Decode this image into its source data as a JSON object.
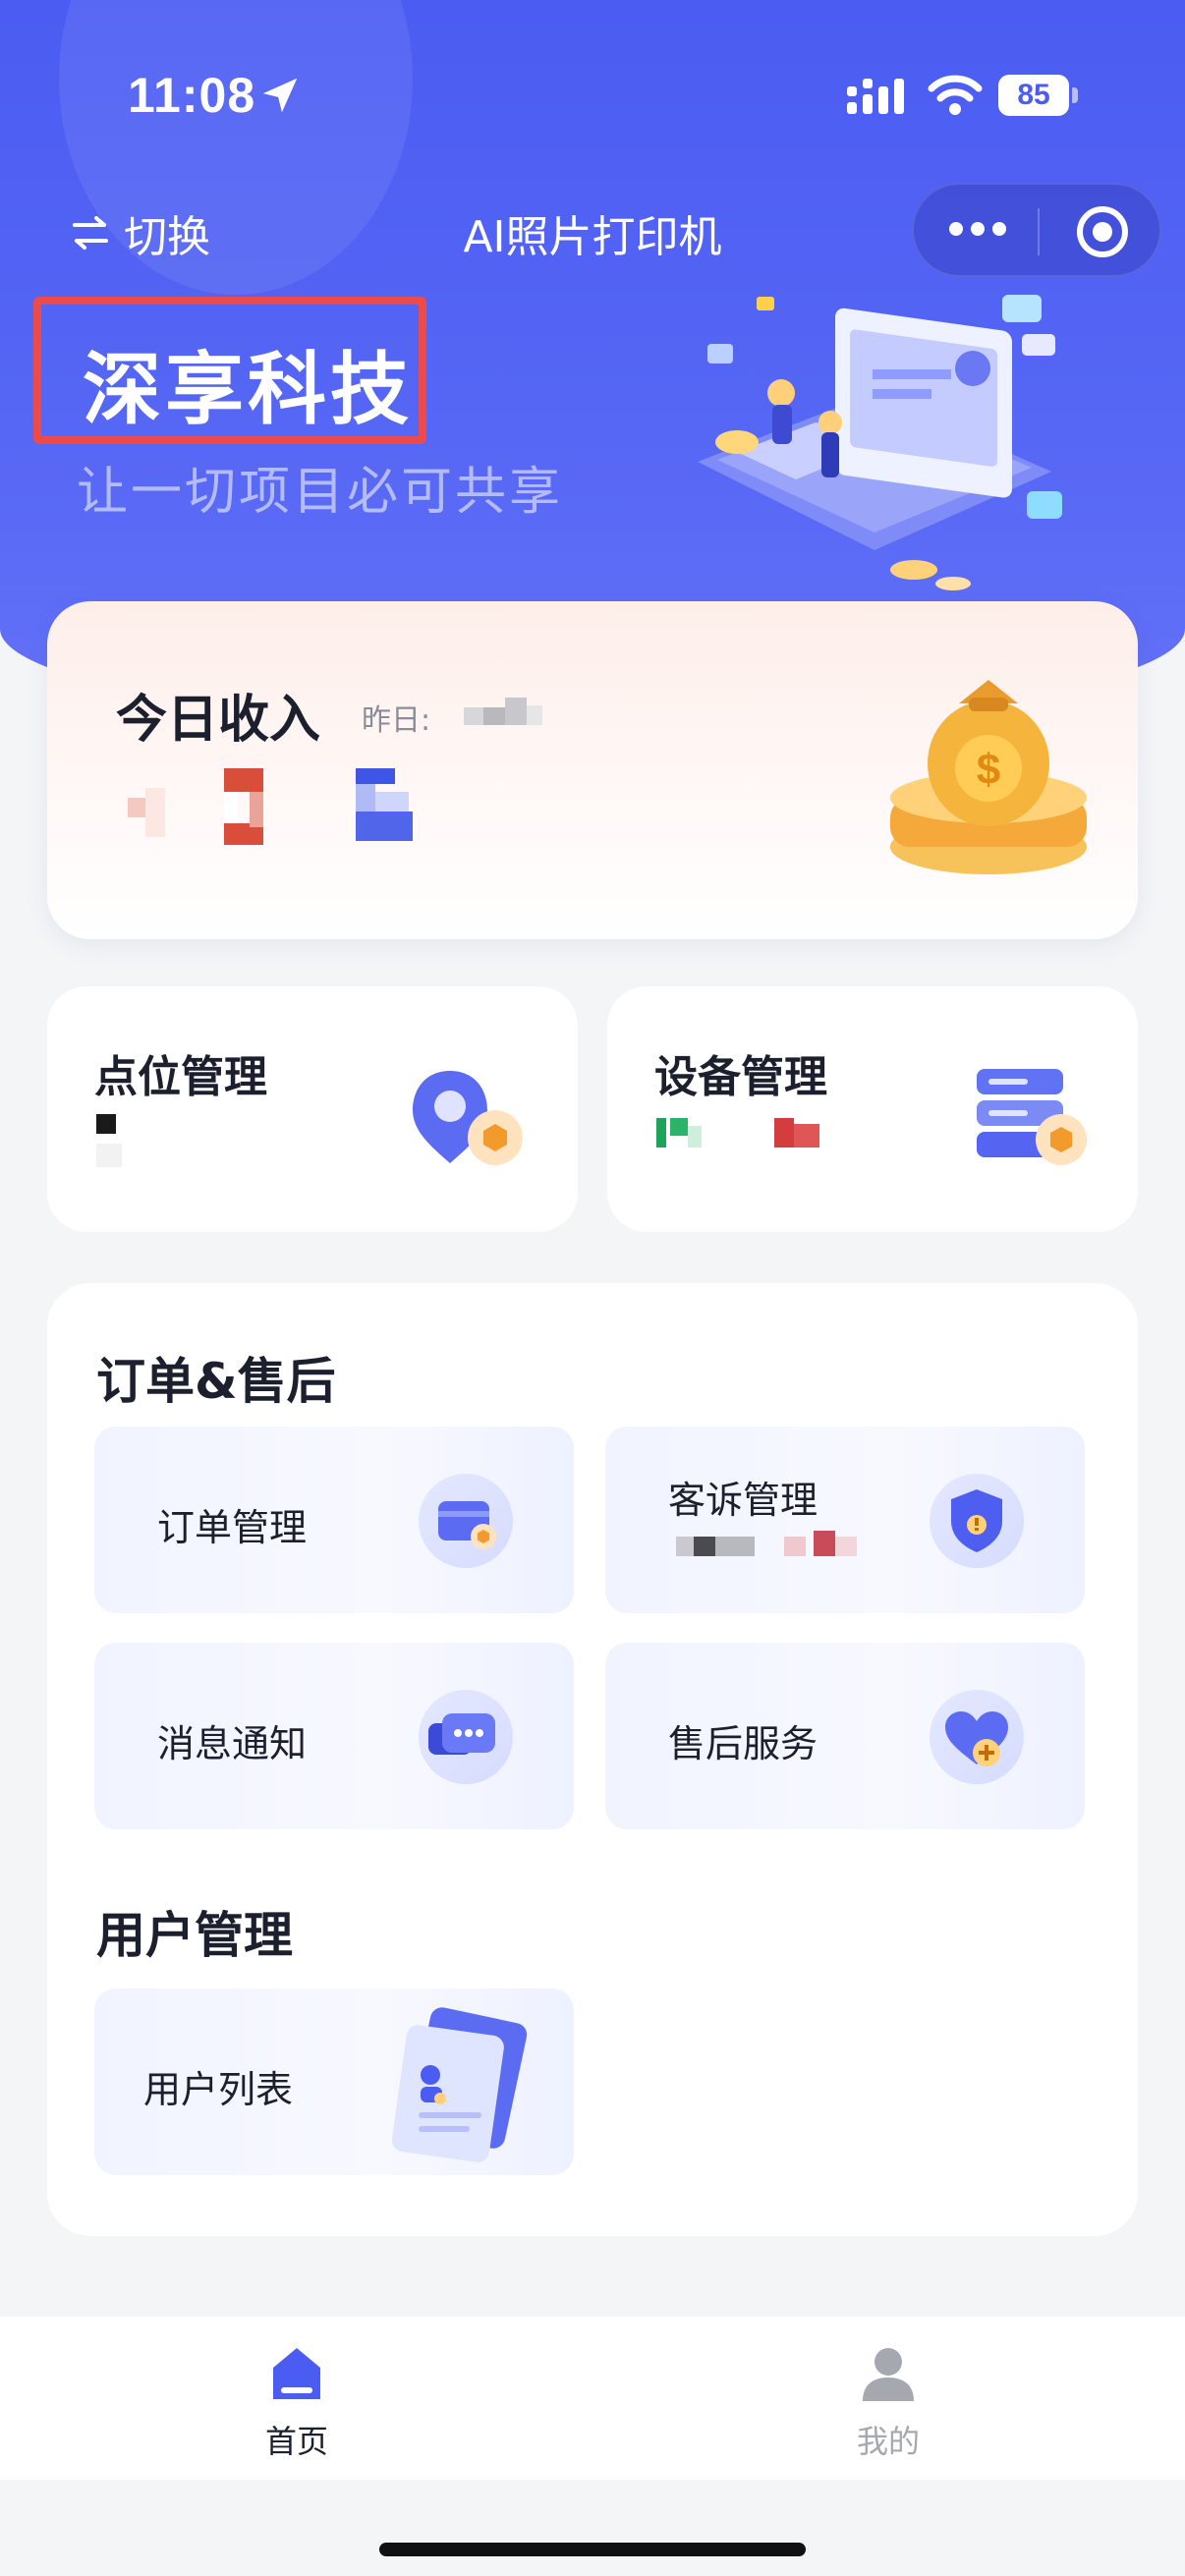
{
  "status": {
    "time": "11:08",
    "battery": "85"
  },
  "nav": {
    "switch_label": "切换",
    "title": "AI照片打印机"
  },
  "brand": {
    "name": "深享科技",
    "slogan": "让一切项目必可共享"
  },
  "income": {
    "title": "今日收入",
    "yesterday_label": "昨日:"
  },
  "cards": {
    "point": "点位管理",
    "device": "设备管理"
  },
  "orders": {
    "title": "订单&售后",
    "tiles": [
      {
        "label": "订单管理",
        "icon": "order-card-icon"
      },
      {
        "label": "客诉管理",
        "icon": "complaint-shield-icon"
      },
      {
        "label": "消息通知",
        "icon": "message-chat-icon"
      },
      {
        "label": "售后服务",
        "icon": "heart-plus-icon"
      }
    ]
  },
  "users": {
    "title": "用户管理",
    "tiles": [
      {
        "label": "用户列表",
        "icon": "user-document-icon"
      }
    ]
  },
  "tabbar": {
    "items": [
      {
        "label": "首页",
        "icon": "home-icon",
        "active": true
      },
      {
        "label": "我的",
        "icon": "profile-icon",
        "active": false
      }
    ]
  },
  "colors": {
    "primary": "#4b5cf2",
    "highlight_border": "#ef4a4a",
    "tab_active": "#1c1f2e",
    "tab_inactive": "#a6a8b0"
  }
}
